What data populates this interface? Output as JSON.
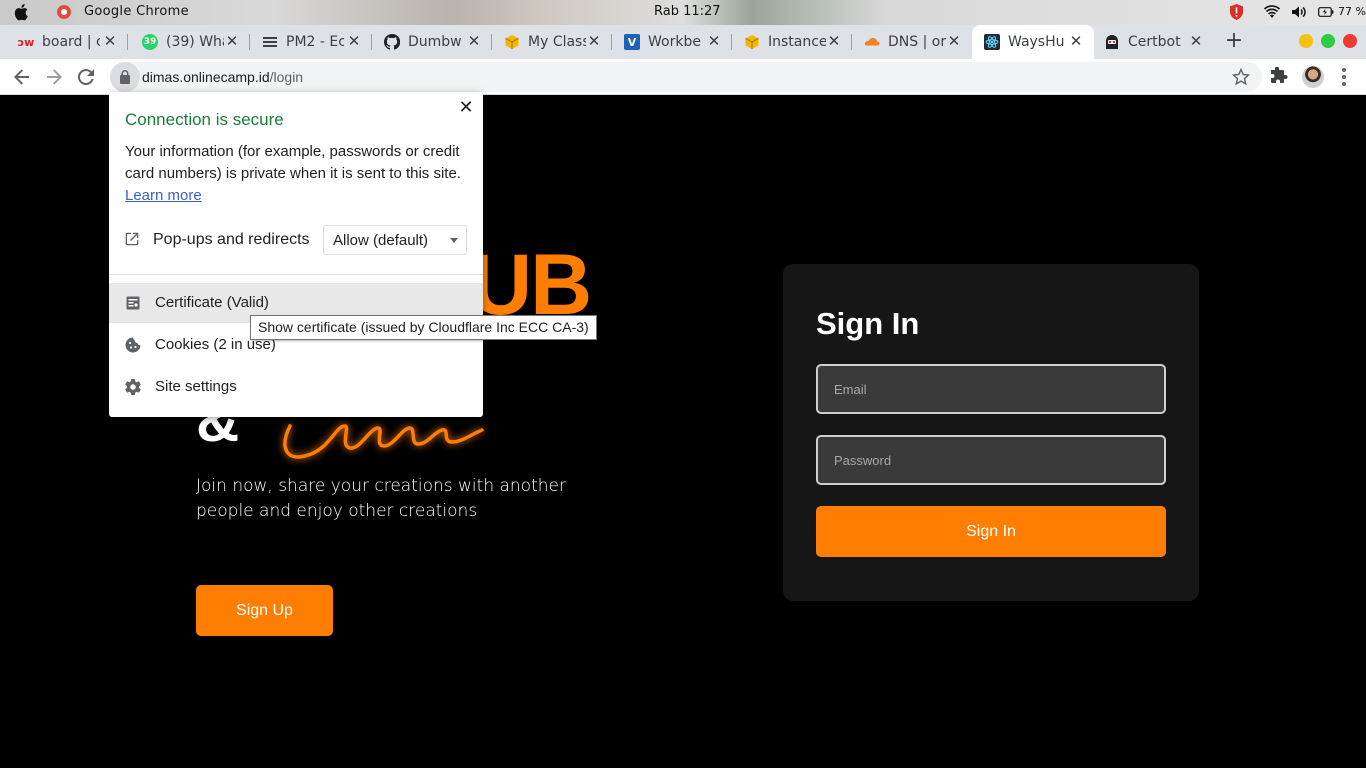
{
  "os_bar": {
    "app_name": "Google Chrome",
    "clock": "Rab 11:27",
    "battery": "77 %"
  },
  "tabs": [
    {
      "title": "board | c",
      "icon": "dumbways-icon"
    },
    {
      "title": "(39) Wha",
      "icon": "whatsapp-icon"
    },
    {
      "title": "PM2 - Ec",
      "icon": "menu-lines-icon"
    },
    {
      "title": "Dumbw",
      "icon": "github-icon"
    },
    {
      "title": "My Class",
      "icon": "box-icon"
    },
    {
      "title": "Workbe",
      "icon": "v-logo-icon"
    },
    {
      "title": "Instance",
      "icon": "box-icon"
    },
    {
      "title": "DNS | or",
      "icon": "cloudflare-icon"
    },
    {
      "title": "WaysHu",
      "icon": "react-icon"
    },
    {
      "title": "Certbot",
      "icon": "certbot-icon"
    }
  ],
  "toolbar": {
    "url_host": "dimas.onlinecamp.id",
    "url_path": "/login"
  },
  "hero": {
    "big_text": "UB",
    "amp": "&",
    "tagline": "Join now, share your creations with another people and enjoy other creations",
    "signup_label": "Sign Up"
  },
  "signin": {
    "title": "Sign In",
    "email_placeholder": "Email",
    "password_placeholder": "Password",
    "button_label": "Sign In"
  },
  "popup": {
    "heading": "Connection is secure",
    "description": "Your information (for example, passwords or credit card numbers) is private when it is sent to this site.",
    "learn_more": "Learn more",
    "permission_label": "Pop-ups and redirects",
    "permission_value": "Allow (default)",
    "certificate_label": "Certificate (Valid)",
    "cookies_label": "Cookies (2 in use)",
    "site_settings_label": "Site settings"
  },
  "tooltip": "Show certificate (issued by Cloudflare Inc ECC CA-3)",
  "colors": {
    "accent": "#ff7d00",
    "secure_green": "#188038",
    "tab_strip": "#dee1e6"
  }
}
